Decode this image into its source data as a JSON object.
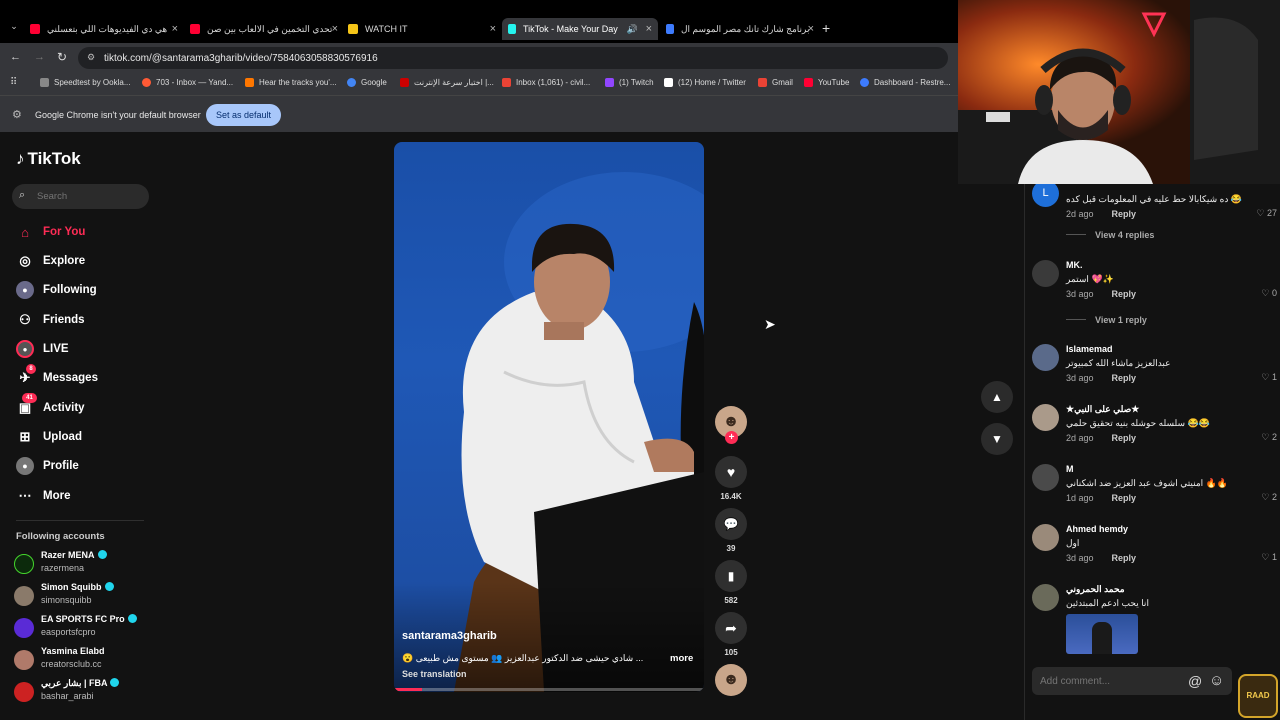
{
  "tabs": [
    {
      "title": "هي دي الفيديوهات اللي بتعسلني",
      "favicon_color": "#ff0033"
    },
    {
      "title": "تحدي التخمين في الالعاب بين صن",
      "favicon_color": "#ff0033"
    },
    {
      "title": "WATCH IT",
      "favicon_color": "#f5c518"
    },
    {
      "title": "TikTok - Make Your Day",
      "favicon_color": "#25f4ee"
    },
    {
      "title": "برنامج شارك تانك مصر الموسم ال",
      "favicon_color": "#3d7bfd"
    }
  ],
  "omnibox": {
    "url": "tiktok.com/@santarama3gharib/video/7584063058830576916"
  },
  "bookmarks": [
    {
      "label": "Speedtest by Ookla...",
      "color": "#888888"
    },
    {
      "label": "703 - Inbox — Yand...",
      "color": "#ff5a35"
    },
    {
      "label": "Hear the tracks you'...",
      "color": "#ff7700"
    },
    {
      "label": "Google",
      "color": "#4285f4"
    },
    {
      "label": "اختبار سرعة الإنترنت |...",
      "color": "#cc0000"
    },
    {
      "label": "Inbox (1,061) - civil...",
      "color": "#ea4335"
    },
    {
      "label": "(1) Twitch",
      "color": "#9146ff"
    },
    {
      "label": "(12) Home / Twitter",
      "color": "#ffffff"
    },
    {
      "label": "Gmail",
      "color": "#ea4335"
    },
    {
      "label": "YouTube",
      "color": "#ff0033"
    },
    {
      "label": "Dashboard - Restre...",
      "color": "#3d7bfd"
    }
  ],
  "infobar": {
    "message": "Google Chrome isn't your default browser",
    "button": "Set as default"
  },
  "sidebar": {
    "logo": "TikTok",
    "search_placeholder": "Search",
    "nav": [
      {
        "label": "For You",
        "icon": "home-icon",
        "glyph": "⌂"
      },
      {
        "label": "Explore",
        "icon": "compass-icon",
        "glyph": "◎"
      },
      {
        "label": "Following",
        "icon": "following-icon",
        "glyph": "●"
      },
      {
        "label": "Friends",
        "icon": "friends-icon",
        "glyph": "⚇"
      },
      {
        "label": "LIVE",
        "icon": "live-icon",
        "glyph": "◉"
      },
      {
        "label": "Messages",
        "icon": "messages-icon",
        "glyph": "✈",
        "badge": "8"
      },
      {
        "label": "Activity",
        "icon": "activity-icon",
        "glyph": "▣",
        "badge": "41"
      },
      {
        "label": "Upload",
        "icon": "upload-icon",
        "glyph": "⊞"
      },
      {
        "label": "Profile",
        "icon": "profile-icon",
        "glyph": "●"
      },
      {
        "label": "More",
        "icon": "more-icon",
        "glyph": "⋯"
      }
    ],
    "following_title": "Following accounts",
    "accounts": [
      {
        "name": "Razer MENA",
        "handle": "razermena",
        "color": "#44d62c"
      },
      {
        "name": "Simon Squibb",
        "handle": "simonsquibb",
        "color": "#8a7a6a"
      },
      {
        "name": "EA SPORTS FC Pro",
        "handle": "easportsfcpro",
        "color": "#5a2bd6"
      },
      {
        "name": "Yasmina Elabd",
        "handle": "creatorsclub.cc",
        "color": "#b07a6a"
      },
      {
        "name": "بشار عربي | FBA",
        "handle": "bashar_arabi",
        "color": "#cc2222"
      }
    ]
  },
  "video": {
    "author": "santarama3gharib",
    "caption": "... شادي حيشى ضد الدكتور عبدالعزيز 👥 مستوى مش طبيعى 😮",
    "more": "more",
    "see_translation": "See translation"
  },
  "actions": {
    "likes": "16.4K",
    "comments": "39",
    "saves": "582",
    "shares": "105"
  },
  "comments": [
    {
      "name": "",
      "text": "ده شيكابالا حط عليه في المعلومات قبل كده 😂",
      "time": "2d ago",
      "likes": "27",
      "avatar_color": "#1e6fd9",
      "initial": "L"
    },
    {
      "name": "MK.",
      "text": "استمر 💖✨",
      "time": "3d ago",
      "likes": "0",
      "avatar_color": "#3a3a3a",
      "initial": ""
    },
    {
      "name": "Islamemad",
      "text": "عبدالعزيز ماشاء الله كمبيوتر",
      "time": "3d ago",
      "likes": "1",
      "avatar_color": "#5a6a8a",
      "initial": ""
    },
    {
      "name": "★صلي على النبي★",
      "text": "سلسله حوشله بنيه تحقيق حلمي 😂😂",
      "time": "2d ago",
      "likes": "2",
      "avatar_color": "#aa9a8a",
      "initial": ""
    },
    {
      "name": "M",
      "text": "امنيتي اشوف عبد العزيز ضد اشكناني 🔥🔥",
      "time": "1d ago",
      "likes": "2",
      "avatar_color": "#4a4a4a",
      "initial": ""
    },
    {
      "name": "Ahmed hemdy",
      "text": "اول",
      "time": "3d ago",
      "likes": "1",
      "avatar_color": "#9a8a7a",
      "initial": ""
    },
    {
      "name": "محمد الحمروني",
      "text": "انا يحب ادعم المبتدئين",
      "time": "",
      "likes": "",
      "avatar_color": "#6a6a5a",
      "initial": ""
    }
  ],
  "reply_label": "Reply",
  "view_replies": [
    "View 4 replies",
    "View 1 reply"
  ],
  "add_comment_placeholder": "Add comment...",
  "overlay": {
    "logo": "RAAD"
  },
  "colors": {
    "accent": "#fe2c55",
    "badge": "#fe2c55",
    "verified": "#20d5ec"
  }
}
